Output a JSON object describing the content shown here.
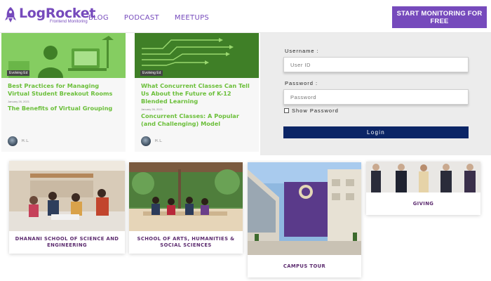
{
  "header": {
    "logo_name": "LogRocket",
    "logo_sub": "Frontend Monitoring",
    "nav": [
      "BLOG",
      "PODCAST",
      "MEETUPS"
    ],
    "cta": "START MONITORING FOR FREE",
    "brand_color": "#764abc"
  },
  "blog": [
    {
      "tag": "Evolving Ed",
      "title": "Best Practices for Managing Virtual Student Breakout Rooms",
      "date": "January 26, 2021",
      "link": "The Benefits of Virtual Grouping",
      "author": "H. L."
    },
    {
      "tag": "Evolving Ed",
      "title": "What Concurrent Classes Can Tell Us About the Future of K-12 Blended Learning",
      "date": "January 26, 2021",
      "link": "Concurrent Classes: A Popular (and Challenging) Model",
      "author": "H. L."
    }
  ],
  "login": {
    "username_label": "Username :",
    "username_placeholder": "User ID",
    "password_label": "Password :",
    "password_placeholder": "Password",
    "show_password": "Show Password",
    "button": "Login",
    "button_color": "#0b2566"
  },
  "tiles": [
    {
      "label": "DHANANI SCHOOL OF SCIENCE AND ENGINEERING"
    },
    {
      "label": "SCHOOL OF ARTS, HUMANITIES & SOCIAL SCIENCES"
    },
    {
      "label": "CAMPUS TOUR"
    },
    {
      "label": "GIVING"
    }
  ],
  "colors": {
    "accent_green": "#6bbf3a",
    "tile_label": "#5b2a6e"
  }
}
